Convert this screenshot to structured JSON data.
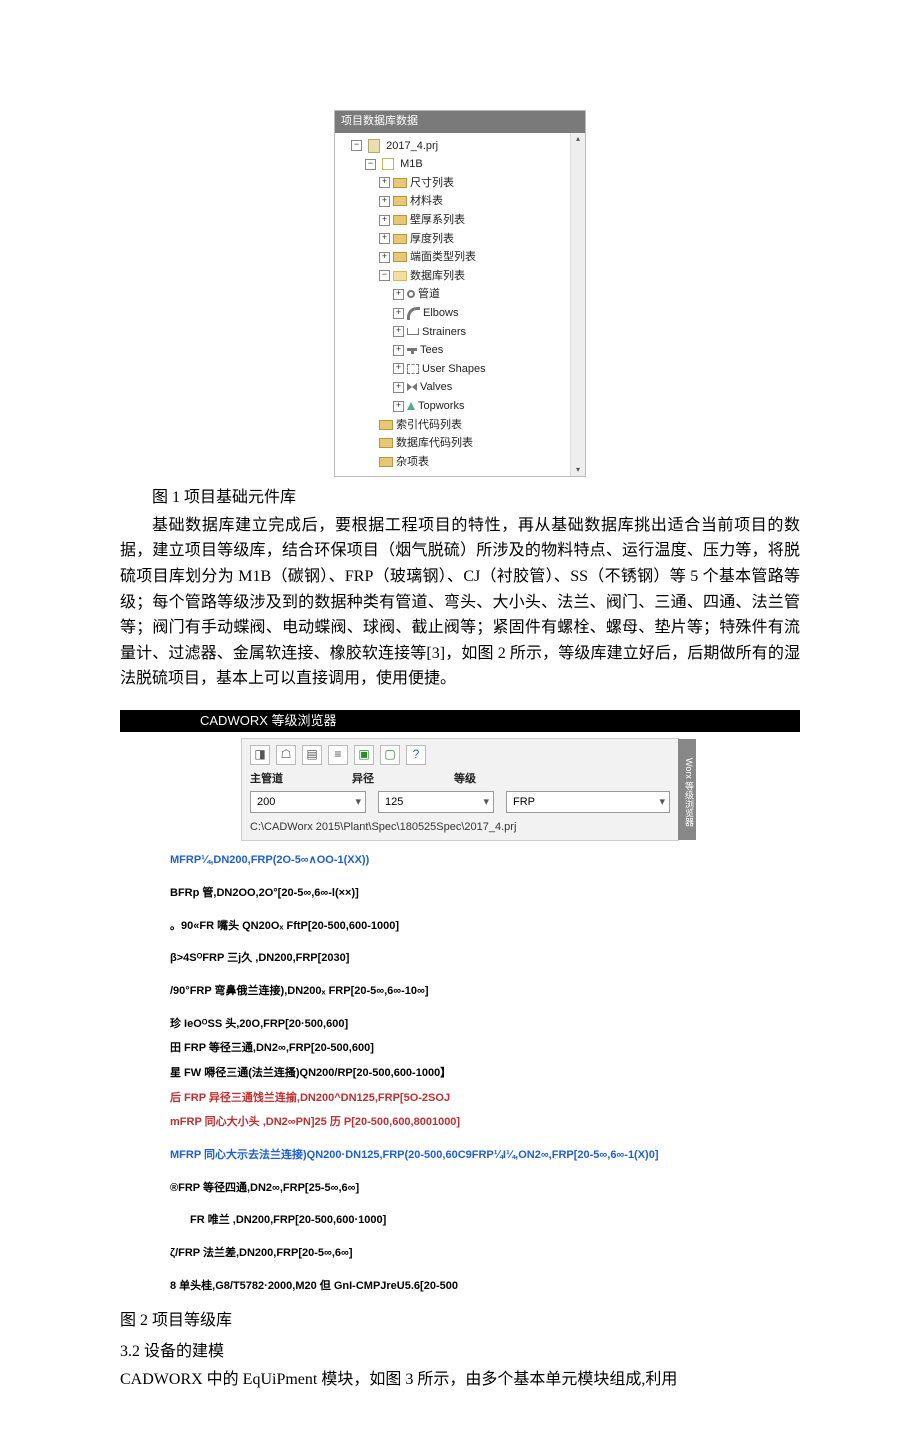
{
  "tree_panel": {
    "title": "项目数据库数据",
    "root": "2017_4.prj",
    "category": "M1B",
    "folders": [
      "尺寸列表",
      "材料表",
      "壁厚系列表",
      "厚度列表",
      "端面类型列表"
    ],
    "dblist_label": "数据库列表",
    "dblist_items": [
      {
        "name": "管道",
        "icon": "pipe"
      },
      {
        "name": "Elbows",
        "icon": "elbow"
      },
      {
        "name": "Strainers",
        "icon": "strainer"
      },
      {
        "name": "Tees",
        "icon": "tee"
      },
      {
        "name": "User Shapes",
        "icon": "usershape"
      },
      {
        "name": "Valves",
        "icon": "valve"
      },
      {
        "name": "Topworks",
        "icon": "topworks"
      }
    ],
    "bottom_folders": [
      "索引代码列表",
      "数据库代码列表",
      "杂项表"
    ]
  },
  "caption1": "图 1 项目基础元件库",
  "para1": "基础数据库建立完成后，要根据工程项目的特性，再从基础数据库挑出适合当前项目的数据，建立项目等级库，结合环保项目（烟气脱硫）所涉及的物料特点、运行温度、压力等，将脱硫项目库划分为 M1B（碳钢）、FRP（玻璃钢）、CJ（衬胶管）、SS（不锈钢）等 5 个基本管路等级；每个管路等级涉及到的数据种类有管道、弯头、大小头、法兰、阀门、三通、四通、法兰管等；阀门有手动蝶阀、电动蝶阀、球阀、截止阀等；紧固件有螺栓、螺母、垫片等；特殊件有流量计、过滤器、金属软连接、橡胶软连接等[3]，如图 2 所示，等级库建立好后，后期做所有的湿法脱硫项目，基本上可以直接调用，使用便捷。",
  "cadworx": {
    "window_title": "CADWORX 等级浏览器",
    "side_tab": "Worx 等级浏览器",
    "labels": {
      "main": "主管道",
      "reduce": "异径",
      "spec": "等级"
    },
    "selects": {
      "main": "200",
      "reduce": "125",
      "spec": "FRP"
    },
    "path": "C:\\CADWorx 2015\\Plant\\Spec\\180525Spec\\2017_4.prj"
  },
  "spec_lines": [
    {
      "cls": "blue",
      "text": "MFRP¼,DN200,FRP(2O-5∞∧OO-1(XX))"
    },
    {
      "cls": "",
      "text": "BFRp 管,DN2OO,2O°[20-5∞,6∞-l(××)]"
    },
    {
      "cls": "",
      "text": "。90«FR 嘴头 QN20Oₓ FftP[20-500,600-1000]"
    },
    {
      "cls": "",
      "text": "β>4SᴼFRP 三j久 ,DN200,FRP[2030]"
    },
    {
      "cls": "",
      "text": "/90°FRP 弯鼻俄兰连接),DN200ₓ FRP[20-5∞,6∞-10∞]"
    },
    {
      "cls": "",
      "text": "珍 IeOᴼSS 头,20O,FRP[20·500,600]"
    },
    {
      "cls": "",
      "text": "田 FRP 等径三通,DN2∞,FRP[20-500,600]"
    },
    {
      "cls": "",
      "text": "星 FW 嘚径三通(法兰连搔)QN200/RP[20-500,600-1000】"
    },
    {
      "cls": "red",
      "text": "后 FRP 异径三通饯兰连揄,DN200^DN125,FRP[5O-2SOJ"
    },
    {
      "cls": "red",
      "text": "mFRP 同心大小头 ,DN2∞PN]25 历 P[20-500,600,8001000]"
    },
    {
      "cls": "blue",
      "text": "MFRP 同心大示去法兰连接)QN200·DN125,FRP(20-500,60C9FRP¼I¼,ON2∞,FRP[20-5∞,6∞-1(X)0]"
    },
    {
      "cls": "",
      "text": "®FRP 等径四通,DN2∞,FRP[25-5∞,6∞]"
    },
    {
      "cls": "indent",
      "text": "FR 唯兰 ,DN200,FRP[20-500,600·1000]"
    },
    {
      "cls": "",
      "text": "ζ/FRP 法兰差,DN200,FRP[20-5∞,6∞]"
    },
    {
      "cls": "",
      "text": "8 单头桂,G8/T5782·2000,M20 但 GnI-CMPJreU5.6[20-500"
    }
  ],
  "caption2": "图 2 项目等级库",
  "section_heading": "3.2  设备的建模",
  "body_last": "CADWORX 中的 EqUiPment 模块，如图 3 所示，由多个基本单元模块组成,利用"
}
